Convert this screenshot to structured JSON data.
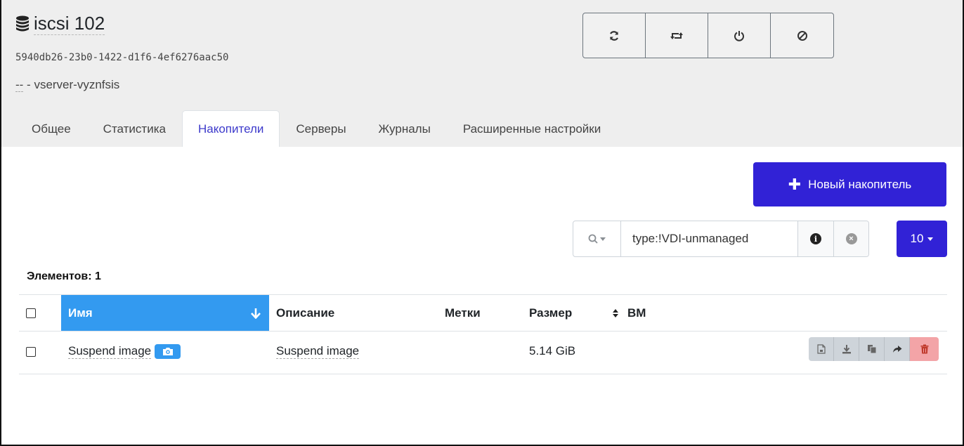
{
  "header": {
    "title": "iscsi 102",
    "uuid": "5940db26-23b0-1422-d1f6-4ef6276aac50",
    "container_dash": "--",
    "container_sep": " - ",
    "container_name": "vserver-vyznfsis",
    "actions": [
      {
        "icon": "refresh-icon"
      },
      {
        "icon": "retweet-icon"
      },
      {
        "icon": "power-icon"
      },
      {
        "icon": "forget-icon"
      }
    ]
  },
  "tabs": [
    {
      "label": "Общее",
      "active": false
    },
    {
      "label": "Статистика",
      "active": false
    },
    {
      "label": "Накопители",
      "active": true
    },
    {
      "label": "Серверы",
      "active": false
    },
    {
      "label": "Журналы",
      "active": false
    },
    {
      "label": "Расширенные настройки",
      "active": false
    }
  ],
  "toolbar": {
    "new_disk_label": "Новый накопитель",
    "filter_value": "type:!VDI-unmanaged",
    "page_size": "10"
  },
  "table": {
    "count_label": "Элементов: 1",
    "columns": {
      "name": "Имя",
      "description": "Описание",
      "tags": "Метки",
      "size": "Размер",
      "vm": "ВМ"
    },
    "rows": [
      {
        "name": "Suspend image",
        "description": "Suspend image",
        "tags": "",
        "size": "5.14 GiB",
        "vm": ""
      }
    ]
  },
  "colors": {
    "primary": "#3122d6",
    "sort_header": "#339af0",
    "header_bg": "#eeeeee",
    "danger_bg": "#f3a4a7"
  }
}
